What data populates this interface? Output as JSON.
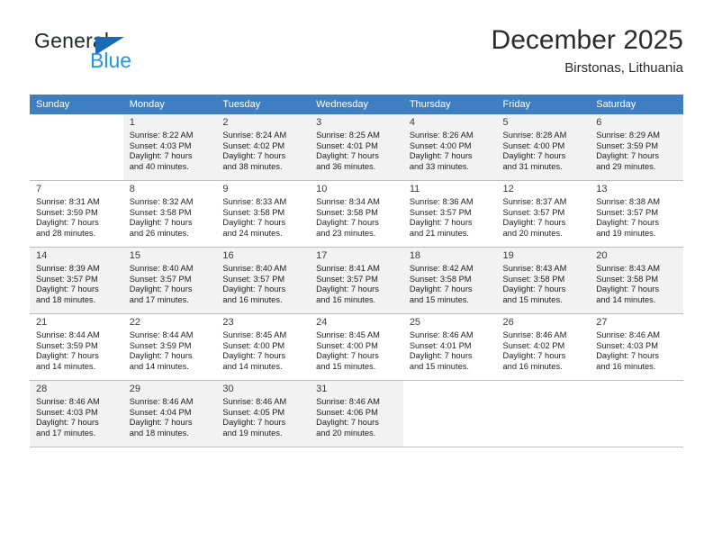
{
  "brand": {
    "name_primary": "General",
    "name_secondary": "Blue",
    "triangle_color": "#1a6bb5",
    "secondary_color": "#2196e3"
  },
  "header": {
    "title": "December 2025",
    "location": "Birstonas, Lithuania"
  },
  "theme": {
    "header_row_bg": "#3f7fc1",
    "header_row_text": "#ffffff",
    "cell_shaded_bg": "#f2f2f2",
    "cell_border": "#bdbdbd"
  },
  "calendar": {
    "weekday_headers": [
      "Sunday",
      "Monday",
      "Tuesday",
      "Wednesday",
      "Thursday",
      "Friday",
      "Saturday"
    ],
    "weeks": [
      [
        {
          "day": "",
          "sunrise": "",
          "sunset": "",
          "daylight_line1": "",
          "daylight_line2": ""
        },
        {
          "day": "1",
          "sunrise": "Sunrise: 8:22 AM",
          "sunset": "Sunset: 4:03 PM",
          "daylight_line1": "Daylight: 7 hours",
          "daylight_line2": "and 40 minutes."
        },
        {
          "day": "2",
          "sunrise": "Sunrise: 8:24 AM",
          "sunset": "Sunset: 4:02 PM",
          "daylight_line1": "Daylight: 7 hours",
          "daylight_line2": "and 38 minutes."
        },
        {
          "day": "3",
          "sunrise": "Sunrise: 8:25 AM",
          "sunset": "Sunset: 4:01 PM",
          "daylight_line1": "Daylight: 7 hours",
          "daylight_line2": "and 36 minutes."
        },
        {
          "day": "4",
          "sunrise": "Sunrise: 8:26 AM",
          "sunset": "Sunset: 4:00 PM",
          "daylight_line1": "Daylight: 7 hours",
          "daylight_line2": "and 33 minutes."
        },
        {
          "day": "5",
          "sunrise": "Sunrise: 8:28 AM",
          "sunset": "Sunset: 4:00 PM",
          "daylight_line1": "Daylight: 7 hours",
          "daylight_line2": "and 31 minutes."
        },
        {
          "day": "6",
          "sunrise": "Sunrise: 8:29 AM",
          "sunset": "Sunset: 3:59 PM",
          "daylight_line1": "Daylight: 7 hours",
          "daylight_line2": "and 29 minutes."
        }
      ],
      [
        {
          "day": "7",
          "sunrise": "Sunrise: 8:31 AM",
          "sunset": "Sunset: 3:59 PM",
          "daylight_line1": "Daylight: 7 hours",
          "daylight_line2": "and 28 minutes."
        },
        {
          "day": "8",
          "sunrise": "Sunrise: 8:32 AM",
          "sunset": "Sunset: 3:58 PM",
          "daylight_line1": "Daylight: 7 hours",
          "daylight_line2": "and 26 minutes."
        },
        {
          "day": "9",
          "sunrise": "Sunrise: 8:33 AM",
          "sunset": "Sunset: 3:58 PM",
          "daylight_line1": "Daylight: 7 hours",
          "daylight_line2": "and 24 minutes."
        },
        {
          "day": "10",
          "sunrise": "Sunrise: 8:34 AM",
          "sunset": "Sunset: 3:58 PM",
          "daylight_line1": "Daylight: 7 hours",
          "daylight_line2": "and 23 minutes."
        },
        {
          "day": "11",
          "sunrise": "Sunrise: 8:36 AM",
          "sunset": "Sunset: 3:57 PM",
          "daylight_line1": "Daylight: 7 hours",
          "daylight_line2": "and 21 minutes."
        },
        {
          "day": "12",
          "sunrise": "Sunrise: 8:37 AM",
          "sunset": "Sunset: 3:57 PM",
          "daylight_line1": "Daylight: 7 hours",
          "daylight_line2": "and 20 minutes."
        },
        {
          "day": "13",
          "sunrise": "Sunrise: 8:38 AM",
          "sunset": "Sunset: 3:57 PM",
          "daylight_line1": "Daylight: 7 hours",
          "daylight_line2": "and 19 minutes."
        }
      ],
      [
        {
          "day": "14",
          "sunrise": "Sunrise: 8:39 AM",
          "sunset": "Sunset: 3:57 PM",
          "daylight_line1": "Daylight: 7 hours",
          "daylight_line2": "and 18 minutes."
        },
        {
          "day": "15",
          "sunrise": "Sunrise: 8:40 AM",
          "sunset": "Sunset: 3:57 PM",
          "daylight_line1": "Daylight: 7 hours",
          "daylight_line2": "and 17 minutes."
        },
        {
          "day": "16",
          "sunrise": "Sunrise: 8:40 AM",
          "sunset": "Sunset: 3:57 PM",
          "daylight_line1": "Daylight: 7 hours",
          "daylight_line2": "and 16 minutes."
        },
        {
          "day": "17",
          "sunrise": "Sunrise: 8:41 AM",
          "sunset": "Sunset: 3:57 PM",
          "daylight_line1": "Daylight: 7 hours",
          "daylight_line2": "and 16 minutes."
        },
        {
          "day": "18",
          "sunrise": "Sunrise: 8:42 AM",
          "sunset": "Sunset: 3:58 PM",
          "daylight_line1": "Daylight: 7 hours",
          "daylight_line2": "and 15 minutes."
        },
        {
          "day": "19",
          "sunrise": "Sunrise: 8:43 AM",
          "sunset": "Sunset: 3:58 PM",
          "daylight_line1": "Daylight: 7 hours",
          "daylight_line2": "and 15 minutes."
        },
        {
          "day": "20",
          "sunrise": "Sunrise: 8:43 AM",
          "sunset": "Sunset: 3:58 PM",
          "daylight_line1": "Daylight: 7 hours",
          "daylight_line2": "and 14 minutes."
        }
      ],
      [
        {
          "day": "21",
          "sunrise": "Sunrise: 8:44 AM",
          "sunset": "Sunset: 3:59 PM",
          "daylight_line1": "Daylight: 7 hours",
          "daylight_line2": "and 14 minutes."
        },
        {
          "day": "22",
          "sunrise": "Sunrise: 8:44 AM",
          "sunset": "Sunset: 3:59 PM",
          "daylight_line1": "Daylight: 7 hours",
          "daylight_line2": "and 14 minutes."
        },
        {
          "day": "23",
          "sunrise": "Sunrise: 8:45 AM",
          "sunset": "Sunset: 4:00 PM",
          "daylight_line1": "Daylight: 7 hours",
          "daylight_line2": "and 14 minutes."
        },
        {
          "day": "24",
          "sunrise": "Sunrise: 8:45 AM",
          "sunset": "Sunset: 4:00 PM",
          "daylight_line1": "Daylight: 7 hours",
          "daylight_line2": "and 15 minutes."
        },
        {
          "day": "25",
          "sunrise": "Sunrise: 8:46 AM",
          "sunset": "Sunset: 4:01 PM",
          "daylight_line1": "Daylight: 7 hours",
          "daylight_line2": "and 15 minutes."
        },
        {
          "day": "26",
          "sunrise": "Sunrise: 8:46 AM",
          "sunset": "Sunset: 4:02 PM",
          "daylight_line1": "Daylight: 7 hours",
          "daylight_line2": "and 16 minutes."
        },
        {
          "day": "27",
          "sunrise": "Sunrise: 8:46 AM",
          "sunset": "Sunset: 4:03 PM",
          "daylight_line1": "Daylight: 7 hours",
          "daylight_line2": "and 16 minutes."
        }
      ],
      [
        {
          "day": "28",
          "sunrise": "Sunrise: 8:46 AM",
          "sunset": "Sunset: 4:03 PM",
          "daylight_line1": "Daylight: 7 hours",
          "daylight_line2": "and 17 minutes."
        },
        {
          "day": "29",
          "sunrise": "Sunrise: 8:46 AM",
          "sunset": "Sunset: 4:04 PM",
          "daylight_line1": "Daylight: 7 hours",
          "daylight_line2": "and 18 minutes."
        },
        {
          "day": "30",
          "sunrise": "Sunrise: 8:46 AM",
          "sunset": "Sunset: 4:05 PM",
          "daylight_line1": "Daylight: 7 hours",
          "daylight_line2": "and 19 minutes."
        },
        {
          "day": "31",
          "sunrise": "Sunrise: 8:46 AM",
          "sunset": "Sunset: 4:06 PM",
          "daylight_line1": "Daylight: 7 hours",
          "daylight_line2": "and 20 minutes."
        },
        {
          "day": "",
          "sunrise": "",
          "sunset": "",
          "daylight_line1": "",
          "daylight_line2": ""
        },
        {
          "day": "",
          "sunrise": "",
          "sunset": "",
          "daylight_line1": "",
          "daylight_line2": ""
        },
        {
          "day": "",
          "sunrise": "",
          "sunset": "",
          "daylight_line1": "",
          "daylight_line2": ""
        }
      ]
    ]
  }
}
